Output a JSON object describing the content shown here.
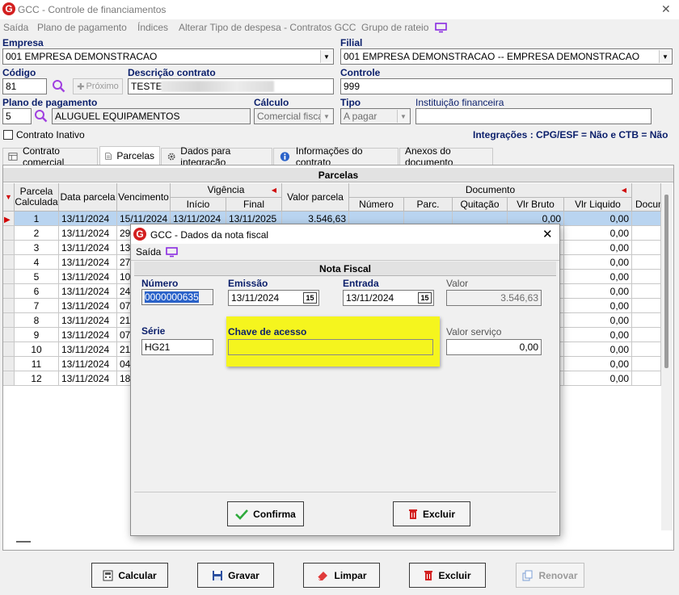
{
  "window": {
    "title": "GCC - Controle de financiamentos",
    "close": "✕"
  },
  "menu": {
    "items": [
      "Saída",
      "Plano de pagamento",
      "Índices",
      "Alterar Tipo de despesa - Contratos GCC",
      "Grupo de rateio"
    ]
  },
  "form": {
    "empresa_label": "Empresa",
    "empresa_value": "001 EMPRESA DEMONSTRACAO",
    "filial_label": "Filial",
    "filial_value": "001 EMPRESA DEMONSTRACAO -- EMPRESA DEMONSTRACAO",
    "codigo_label": "Código",
    "codigo_value": "81",
    "proximo_label": "Próximo",
    "descricao_label": "Descrição contrato",
    "descricao_value": "TESTE",
    "controle_label": "Controle",
    "controle_value": "999",
    "plano_label": "Plano de pagamento",
    "plano_code": "5",
    "plano_value": "ALUGUEL EQUIPAMENTOS",
    "calculo_label": "Cálculo",
    "calculo_value": "Comercial fiscal",
    "tipo_label": "Tipo",
    "tipo_value": "A pagar",
    "instituicao_label": "Instituição financeira",
    "instituicao_value": "",
    "contrato_inativo_label": "Contrato Inativo",
    "integracoes_text": "Integrações : CPG/ESF = Não e CTB = Não"
  },
  "tabs": [
    "Contrato comercial",
    "Parcelas",
    "Dados para integração",
    "Informações do contrato",
    "Anexos do documento"
  ],
  "grid": {
    "title": "Parcelas",
    "headers": {
      "parcela": "Parcela Calculada",
      "data_parcela": "Data parcela",
      "vencimento": "Vencimento",
      "vigencia": "Vigência",
      "inicio": "Início",
      "final": "Final",
      "valor_parcela": "Valor parcela",
      "documento": "Documento",
      "numero": "Número",
      "parc": "Parc.",
      "quitacao": "Quitação",
      "vlr_bruto": "Vlr Bruto",
      "vlr_liquido": "Vlr Liquido",
      "docum": "Docum"
    },
    "rows": [
      {
        "parcela": "1",
        "data": "13/11/2024",
        "venc": "15/11/2024",
        "inicio": "13/11/2024",
        "final": "13/11/2025",
        "valor": "3.546,63",
        "bruto": "0,00",
        "liquido": "0,00"
      },
      {
        "parcela": "2",
        "data": "13/11/2024",
        "venc": "29",
        "inicio": "",
        "final": "",
        "valor": "",
        "bruto": "",
        "liquido": "0,00"
      },
      {
        "parcela": "3",
        "data": "13/11/2024",
        "venc": "13",
        "inicio": "",
        "final": "",
        "valor": "",
        "bruto": "",
        "liquido": "0,00"
      },
      {
        "parcela": "4",
        "data": "13/11/2024",
        "venc": "27",
        "inicio": "",
        "final": "",
        "valor": "",
        "bruto": "",
        "liquido": "0,00"
      },
      {
        "parcela": "5",
        "data": "13/11/2024",
        "venc": "10",
        "inicio": "",
        "final": "",
        "valor": "",
        "bruto": "",
        "liquido": "0,00"
      },
      {
        "parcela": "6",
        "data": "13/11/2024",
        "venc": "24",
        "inicio": "",
        "final": "",
        "valor": "",
        "bruto": "",
        "liquido": "0,00"
      },
      {
        "parcela": "7",
        "data": "13/11/2024",
        "venc": "07",
        "inicio": "",
        "final": "",
        "valor": "",
        "bruto": "",
        "liquido": "0,00"
      },
      {
        "parcela": "8",
        "data": "13/11/2024",
        "venc": "21",
        "inicio": "",
        "final": "",
        "valor": "",
        "bruto": "",
        "liquido": "0,00"
      },
      {
        "parcela": "9",
        "data": "13/11/2024",
        "venc": "07",
        "inicio": "",
        "final": "",
        "valor": "",
        "bruto": "",
        "liquido": "0,00"
      },
      {
        "parcela": "10",
        "data": "13/11/2024",
        "venc": "21",
        "inicio": "",
        "final": "",
        "valor": "",
        "bruto": "",
        "liquido": "0,00"
      },
      {
        "parcela": "11",
        "data": "13/11/2024",
        "venc": "04",
        "inicio": "",
        "final": "",
        "valor": "",
        "bruto": "",
        "liquido": "0,00"
      },
      {
        "parcela": "12",
        "data": "13/11/2024",
        "venc": "18",
        "inicio": "",
        "final": "",
        "valor": "",
        "bruto": "",
        "liquido": "0,00"
      }
    ]
  },
  "buttons": {
    "calcular": "Calcular",
    "gravar": "Gravar",
    "limpar": "Limpar",
    "excluir": "Excluir",
    "renovar": "Renovar"
  },
  "dialog": {
    "title": "GCC - Dados da nota fiscal",
    "menu_saida": "Saída",
    "section_title": "Nota Fiscal",
    "numero_label": "Número",
    "numero_value": "0000000635",
    "emissao_label": "Emissão",
    "emissao_value": "13/11/2024",
    "entrada_label": "Entrada",
    "entrada_value": "13/11/2024",
    "valor_label": "Valor",
    "valor_value": "3.546,63",
    "serie_label": "Série",
    "serie_value": "HG21",
    "chave_label": "Chave de acesso",
    "chave_value": "",
    "valor_servico_label": "Valor serviço",
    "valor_servico_value": "0,00",
    "confirma": "Confirma",
    "excluir": "Excluir",
    "calendar_glyph": "15"
  },
  "colors": {
    "accent": "#0b1f6b",
    "highlight": "#f5f51e",
    "selected_row": "#b9d4f0",
    "brand_red": "#d32020"
  }
}
